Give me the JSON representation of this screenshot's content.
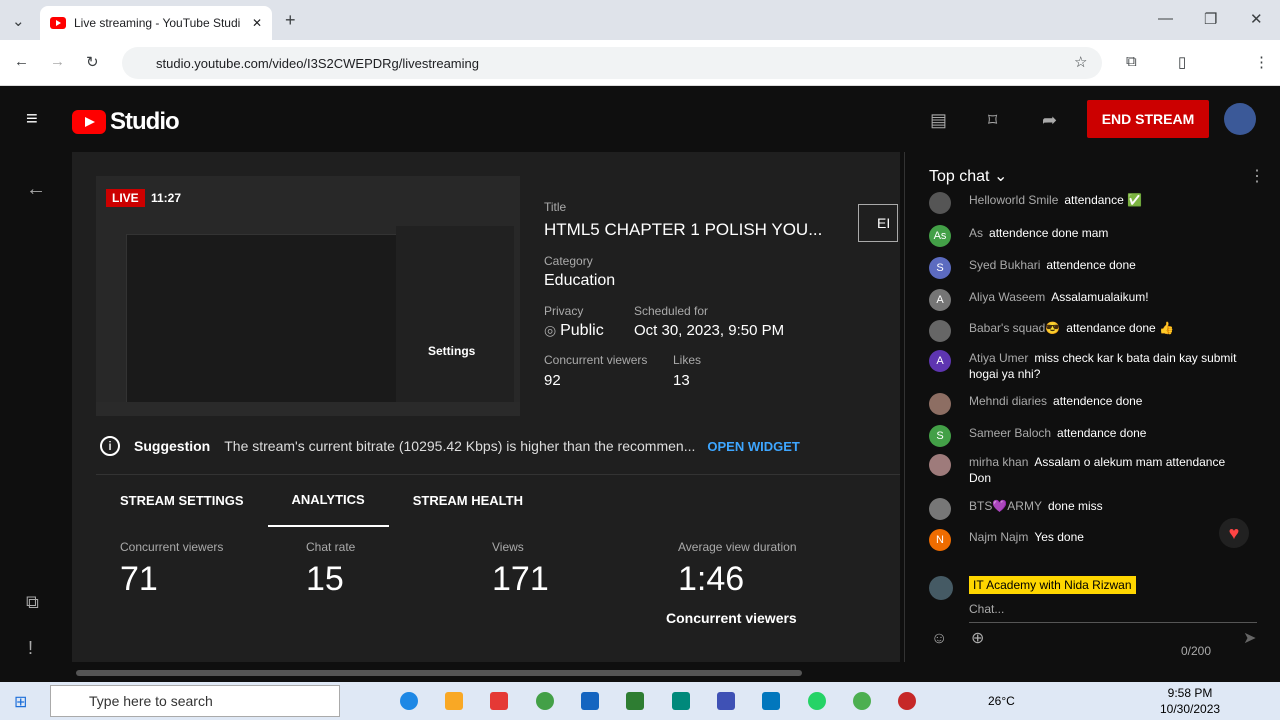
{
  "browser": {
    "tab_title": "Live streaming - YouTube Studi",
    "url": "studio.youtube.com/video/I3S2CWEPDRg/livestreaming"
  },
  "studio": {
    "logo": "Studio",
    "end_stream": "END STREAM"
  },
  "preview": {
    "live": "LIVE",
    "time": "11:27",
    "overlay_settings": "Settings"
  },
  "details": {
    "title_label": "Title",
    "title": "HTML5 CHAPTER 1 POLISH YOU...",
    "category_label": "Category",
    "category": "Education",
    "privacy_label": "Privacy",
    "privacy": "Public",
    "scheduled_label": "Scheduled for",
    "scheduled": "Oct 30, 2023, 9:50 PM",
    "cv_label": "Concurrent viewers",
    "cv": "92",
    "likes_label": "Likes",
    "likes": "13",
    "edit_button": "EI"
  },
  "suggestion": {
    "label": "Suggestion",
    "text": "The stream's current bitrate (10295.42 Kbps) is higher than the recommen...",
    "link": "OPEN WIDGET"
  },
  "tabs": [
    "STREAM SETTINGS",
    "ANALYTICS",
    "STREAM HEALTH"
  ],
  "stats": [
    {
      "label": "Concurrent viewers",
      "value": "71"
    },
    {
      "label": "Chat rate",
      "value": "15"
    },
    {
      "label": "Views",
      "value": "171"
    },
    {
      "label": "Average view duration",
      "value": "1:46"
    }
  ],
  "chart_label": "Concurrent viewers",
  "chat": {
    "header": "Top chat",
    "messages": [
      {
        "name": "Helloworld Smile",
        "text": "attendance ✅",
        "initial": "",
        "color": "#555"
      },
      {
        "name": "As",
        "text": "attendence done mam",
        "initial": "As",
        "color": "#43a047"
      },
      {
        "name": "Syed Bukhari",
        "text": "attendence done",
        "initial": "S",
        "color": "#5c6bc0"
      },
      {
        "name": "Aliya Waseem",
        "text": "Assalamualaikum!",
        "initial": "A",
        "color": "#757575"
      },
      {
        "name": "Babar's squad😎",
        "text": "attendance done 👍",
        "initial": "",
        "color": "#666"
      },
      {
        "name": "Atiya Umer",
        "text": "miss check kar k bata dain kay submit hogai ya nhi?",
        "initial": "A",
        "color": "#5e35b1"
      },
      {
        "name": "Mehndi diaries",
        "text": "attendence done",
        "initial": "",
        "color": "#8d6e63"
      },
      {
        "name": "Sameer Baloch",
        "text": "attendance done",
        "initial": "S",
        "color": "#43a047"
      },
      {
        "name": "mirha khan",
        "text": "Assalam o alekum mam attendance Don",
        "initial": "",
        "color": "#9e7b7b"
      },
      {
        "name": "BTS💜ARMY",
        "text": "done miss",
        "initial": "",
        "color": "#777"
      },
      {
        "name": "Najm Najm",
        "text": "Yes done",
        "initial": "N",
        "color": "#ef6c00"
      }
    ],
    "channel": "IT Academy with Nida Rizwan",
    "placeholder": "Chat...",
    "count": "0/200"
  },
  "taskbar": {
    "search": "Type here to search",
    "temp": "26°C",
    "time": "9:58 PM",
    "date": "10/30/2023"
  }
}
